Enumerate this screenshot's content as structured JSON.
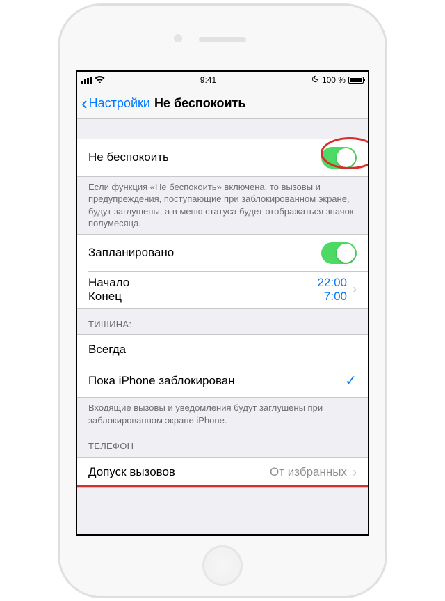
{
  "status": {
    "time": "9:41",
    "battery_pct": "100 %"
  },
  "nav": {
    "back_label": "Настройки",
    "title": "Не беспокоить"
  },
  "dnd": {
    "label": "Не беспокоить",
    "footer": "Если функция «Не беспокоить» включена, то вызовы и предупреждения, поступающие при заблокированном экране, будут заглушены, а в меню статуса будет отображаться значок полумесяца."
  },
  "scheduled": {
    "label": "Запланировано",
    "from_label": "Начало",
    "from_value": "22:00",
    "to_label": "Конец",
    "to_value": "7:00"
  },
  "silence": {
    "header": "ТИШИНА:",
    "always": "Всегда",
    "while_locked": "Пока iPhone заблокирован",
    "footer": "Входящие вызовы и уведомления будут заглушены при заблокированном экране iPhone."
  },
  "phone": {
    "header": "ТЕЛЕФОН",
    "allow_calls_label": "Допуск вызовов",
    "allow_calls_value": "От избранных"
  }
}
